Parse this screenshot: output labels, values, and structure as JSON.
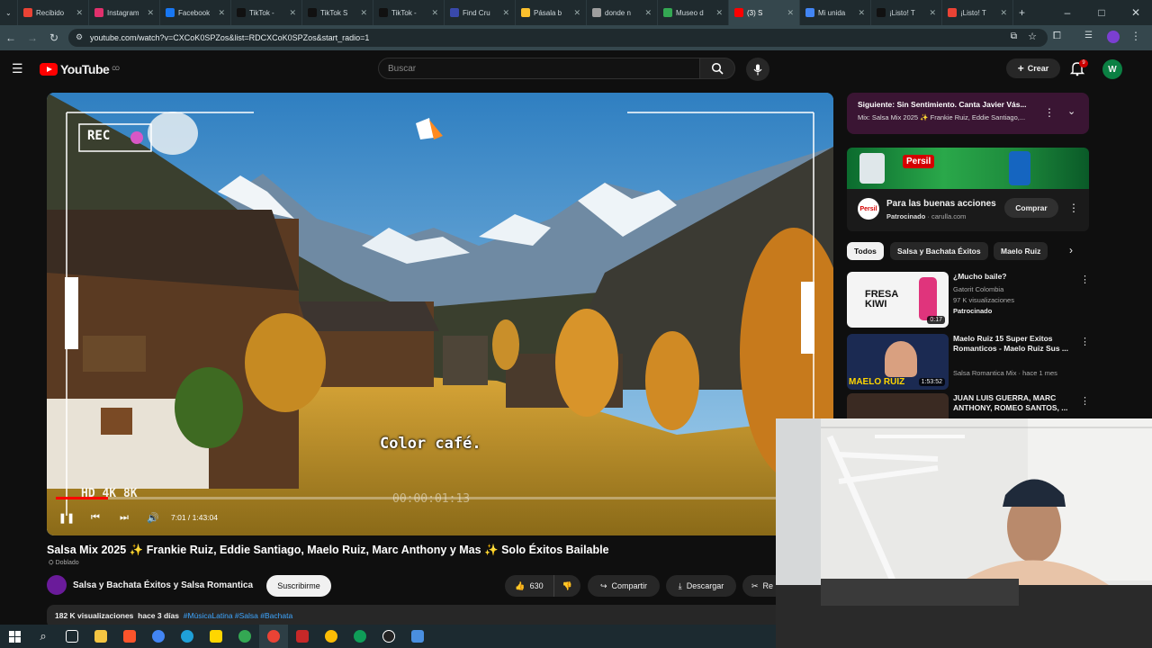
{
  "browser": {
    "tabs": [
      {
        "label": "Recibido",
        "color": "#ea4335"
      },
      {
        "label": "Instagram",
        "color": "#e1306c"
      },
      {
        "label": "Facebook",
        "color": "#1877f2"
      },
      {
        "label": "TikTok -",
        "color": "#111111"
      },
      {
        "label": "TikTok S",
        "color": "#111111"
      },
      {
        "label": "TikTok -",
        "color": "#111111"
      },
      {
        "label": "Find Cru",
        "color": "#3949ab"
      },
      {
        "label": "Pásala b",
        "color": "#fbc02d"
      },
      {
        "label": "donde n",
        "color": "#9e9e9e"
      },
      {
        "label": "Museo d",
        "color": "#34a853"
      },
      {
        "label": "(3) S",
        "color": "#ff0000",
        "active": true
      },
      {
        "label": "Mi unida",
        "color": "#4285f4"
      },
      {
        "label": "¡Listo! T",
        "color": "#111111"
      },
      {
        "label": "¡Listo! T",
        "color": "#ea4335"
      }
    ],
    "url": "youtube.com/watch?v=CXCoK0SPZos&list=RDCXCoK0SPZos&start_radio=1"
  },
  "header": {
    "logo_text": "YouTube",
    "logo_sup": "CO",
    "search_placeholder": "Buscar",
    "create_label": "Crear",
    "notif_count": "9",
    "avatar_letter": "W"
  },
  "player": {
    "rec_label": "REC",
    "caption": "Color café.",
    "overlay_left": "HD 4K 8K",
    "overlay_timecode": "00:00:01:13",
    "time": "7:01 / 1:43:04",
    "progress_fraction": 0.068
  },
  "video": {
    "title": "Salsa Mix 2025 ✨ Frankie Ruiz, Eddie Santiago, Maelo Ruiz, Marc Anthony y Mas ✨ Solo Éxitos Bailable",
    "dubbed": "Doblado",
    "channel": "Salsa y Bachata Éxitos y Salsa Romantica",
    "subscribe": "Suscribirme",
    "likes": "630",
    "share": "Compartir",
    "download": "Descargar",
    "clip": "Re",
    "views": "182 K visualizaciones",
    "date": "hace 3 días",
    "tags": "#MúsicaLatina #Salsa #Bachata"
  },
  "sidebar": {
    "next_title": "Siguiente: Sin Sentimiento. Canta Javier Vás...",
    "next_sub": "Mix: Salsa Mix 2025 ✨ Frankie Ruiz, Eddie Santiago,...",
    "ad_logo": "Persil",
    "ad_title": "Para las buenas acciones",
    "ad_sponsored": "Patrocinado",
    "ad_domain": "carulla.com",
    "ad_button": "Comprar",
    "chips": [
      "Todos",
      "Salsa y Bachata Éxitos",
      "Maelo Ruiz"
    ],
    "recs": [
      {
        "title": "¿Mucho baile?",
        "channel": "Gatorit Colombia",
        "meta": "97 K visualizaciones",
        "extra": "Patrocinado",
        "duration": "0:17",
        "thumb_text": "FRESA KIWI"
      },
      {
        "title": "Maelo Ruiz 15 Super Exitos Romanticos - Maelo Ruiz Sus ...",
        "channel": "Salsa Romantica Mix",
        "meta": "Salsa Romantica Mix · hace 1 mes",
        "extra": "",
        "duration": "1:53:52",
        "thumb_text": "MAELO RUIZ"
      },
      {
        "title": "JUAN LUIS GUERRA, MARC ANTHONY, ROMEO SANTOS, ...",
        "channel": "",
        "meta": "",
        "extra": "",
        "duration": "",
        "thumb_text": ""
      }
    ]
  }
}
